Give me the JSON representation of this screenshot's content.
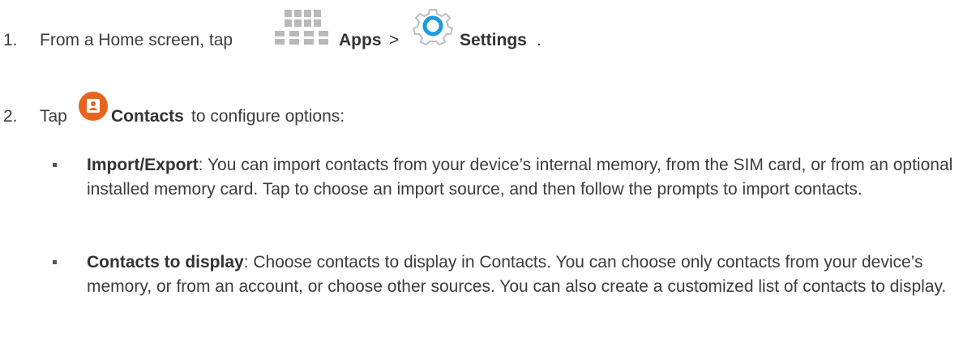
{
  "steps": [
    {
      "number": "1.",
      "prefix": "From a Home screen, tap ",
      "apps_label": "Apps",
      "separator": " > ",
      "settings_label": "Settings",
      "suffix": ".",
      "icons": [
        "apps-grid-icon",
        "settings-gear-icon"
      ]
    },
    {
      "number": "2.",
      "prefix": "Tap ",
      "contacts_label": "Contacts",
      "suffix": " to configure options:",
      "icons": [
        "contacts-app-icon"
      ]
    }
  ],
  "options": [
    {
      "term": "Import/Export",
      "description": ": You can import contacts from your device’s internal memory, from the SIM card, or from an optional installed memory card. Tap to choose an import source, and then follow the prompts to import contacts."
    },
    {
      "term": "Contacts to display",
      "description": ": Choose contacts to display in Contacts. You can choose only contacts from your device’s memory, or from an account, or choose other sources. You can also create a customized list of contacts to display."
    }
  ],
  "colors": {
    "text": "#3c3c3c",
    "apps_icon": "#b9b9b9",
    "settings_icon": "#1e9be0",
    "contacts_icon": "#e8641e"
  }
}
